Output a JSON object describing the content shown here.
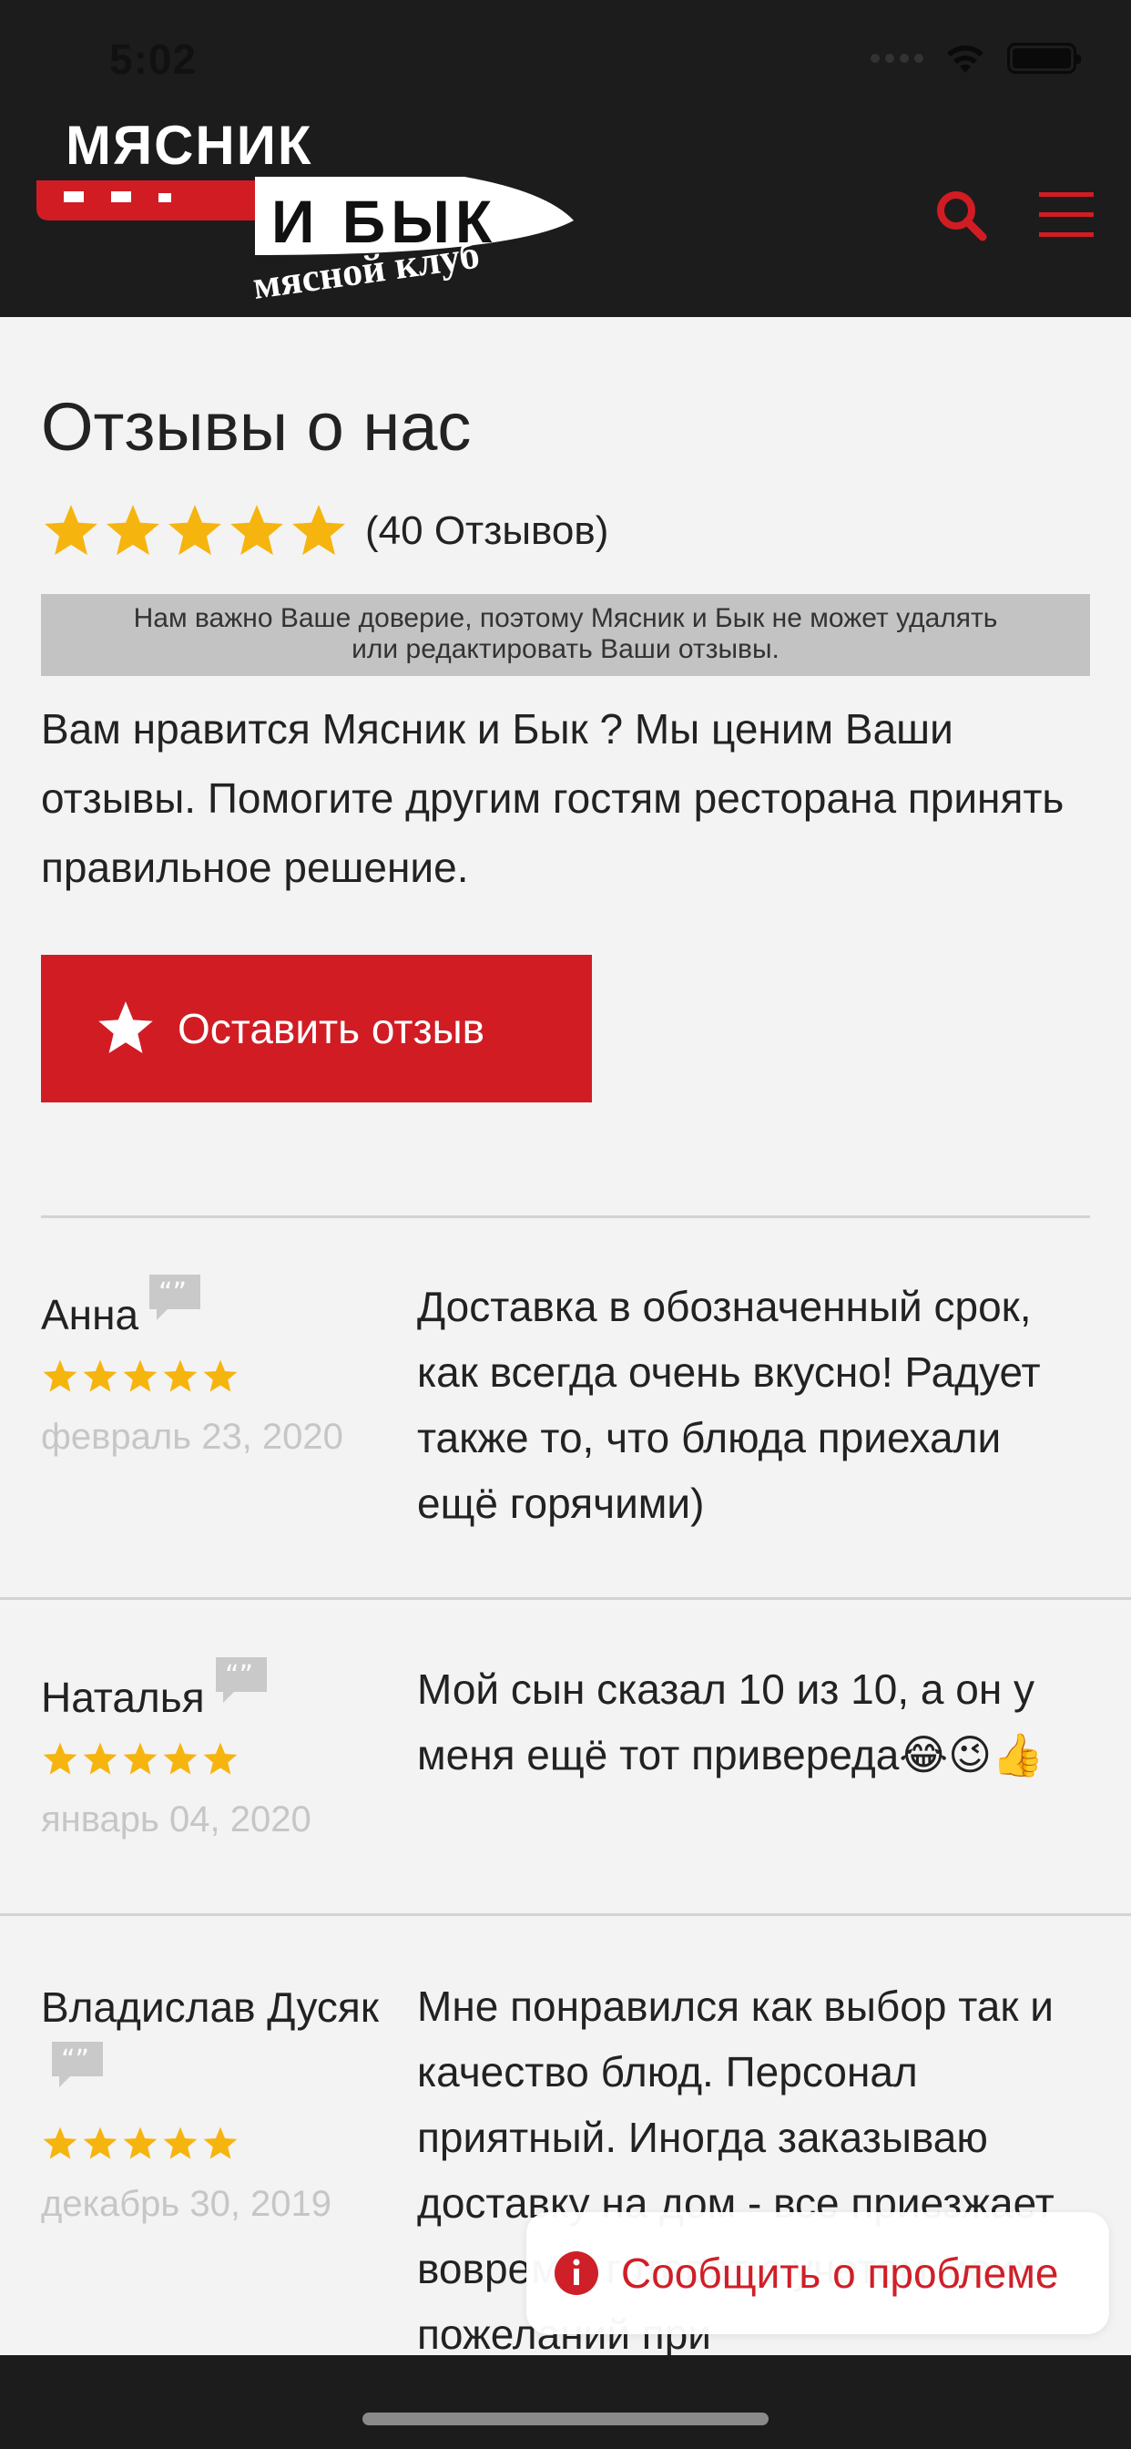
{
  "status_bar": {
    "time": "5:02"
  },
  "header": {
    "logo_line1": "МЯСНИК",
    "logo_line2": "И БЫК",
    "logo_line3": "мясной клуб"
  },
  "page": {
    "title": "Отзывы о нас",
    "rating": 5,
    "review_count_label": "(40 Отзывов)",
    "notice_line1": "Нам важно Ваше доверие, поэтому Мясник и Бык не может удалять",
    "notice_line2": "или редактировать Ваши отзывы.",
    "intro": "Вам нравится Мясник и Бык ? Мы ценим Ваши отзывы. Помогите другим гостям ресторана принять правильное решение.",
    "cta_label": "Оставить отзыв"
  },
  "reviews": [
    {
      "name": "Анна",
      "rating": 5,
      "date": "февраль 23, 2020",
      "text": "Доставка в обозначенный срок, как всегда очень вкусно! Радует также то, что блюда приехали ещё горячими)"
    },
    {
      "name": "Наталья",
      "rating": 5,
      "date": "январь 04, 2020",
      "text": "Мой сын сказал 10 из 10, а он у меня ещё тот привереда😂😉👍"
    },
    {
      "name": "Владислав Дусяк",
      "rating": 5,
      "date": "декабрь 30, 2019",
      "text": "Мне понравился как выбор так и качество блюд. Персонал приятный. Иногда заказываю доставку на дом - все приезжает вовремя, готовят с учетом моих пожеланий при"
    }
  ],
  "report_button": {
    "label": "Сообщить о проблеме"
  },
  "colors": {
    "accent": "#d11c24",
    "star": "#f6b40e",
    "header_bg": "#1c1c1c",
    "page_bg": "#f3f3f3"
  },
  "icons": {
    "search": "search-icon",
    "menu": "hamburger-menu-icon",
    "star": "star-icon",
    "quote": "quote-bubble-icon",
    "info": "info-icon"
  }
}
